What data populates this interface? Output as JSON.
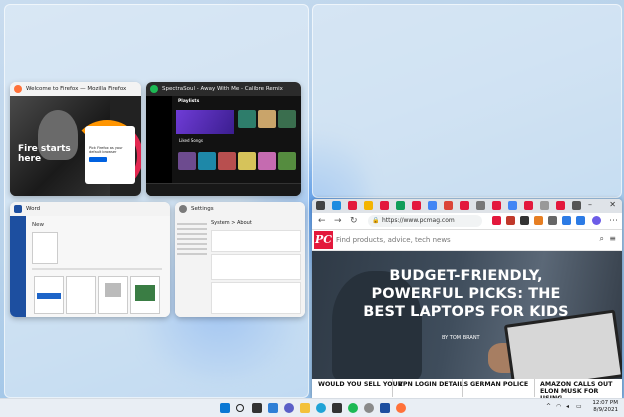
{
  "thumbnails": {
    "firefox": {
      "title": "Welcome to Firefox — Mozilla Firefox",
      "hero": "Fire starts here",
      "card_text": "Pick Firefox as your default browser"
    },
    "spotify": {
      "title": "SpectraSoul - Away With Me - Calibre Remix",
      "section": "Playlists",
      "liked": "Liked Songs"
    },
    "word": {
      "title": "Word",
      "new_label": "New"
    },
    "settings": {
      "title": "Settings",
      "breadcrumb": "System  >  About"
    }
  },
  "browser": {
    "url": "https://www.pcmag.com",
    "search_placeholder": "Find products, advice, tech news",
    "logo": "PC",
    "hero_title": "BUDGET-FRIENDLY, POWERFUL PICKS: THE BEST LAPTOPS FOR KIDS",
    "byline": "BY TOM BRANT",
    "headlines": [
      "WOULD YOU SELL YOUR",
      "VPN LOGIN DETAILS",
      "GERMAN POLICE",
      "AMAZON CALLS OUT ELON MUSK FOR USING"
    ]
  },
  "taskbar": {
    "icons": [
      "windows-start",
      "search",
      "task-view",
      "widgets",
      "chat",
      "file-explorer",
      "edge",
      "store",
      "spotify",
      "settings",
      "word",
      "firefox"
    ],
    "time": "12:07 PM",
    "date": "8/9/2021"
  },
  "colors": {
    "pcmag_red": "#e3183c",
    "word_blue": "#1d4fa0",
    "spotify_green": "#1db954",
    "firefox_orange": "#ff7139"
  }
}
